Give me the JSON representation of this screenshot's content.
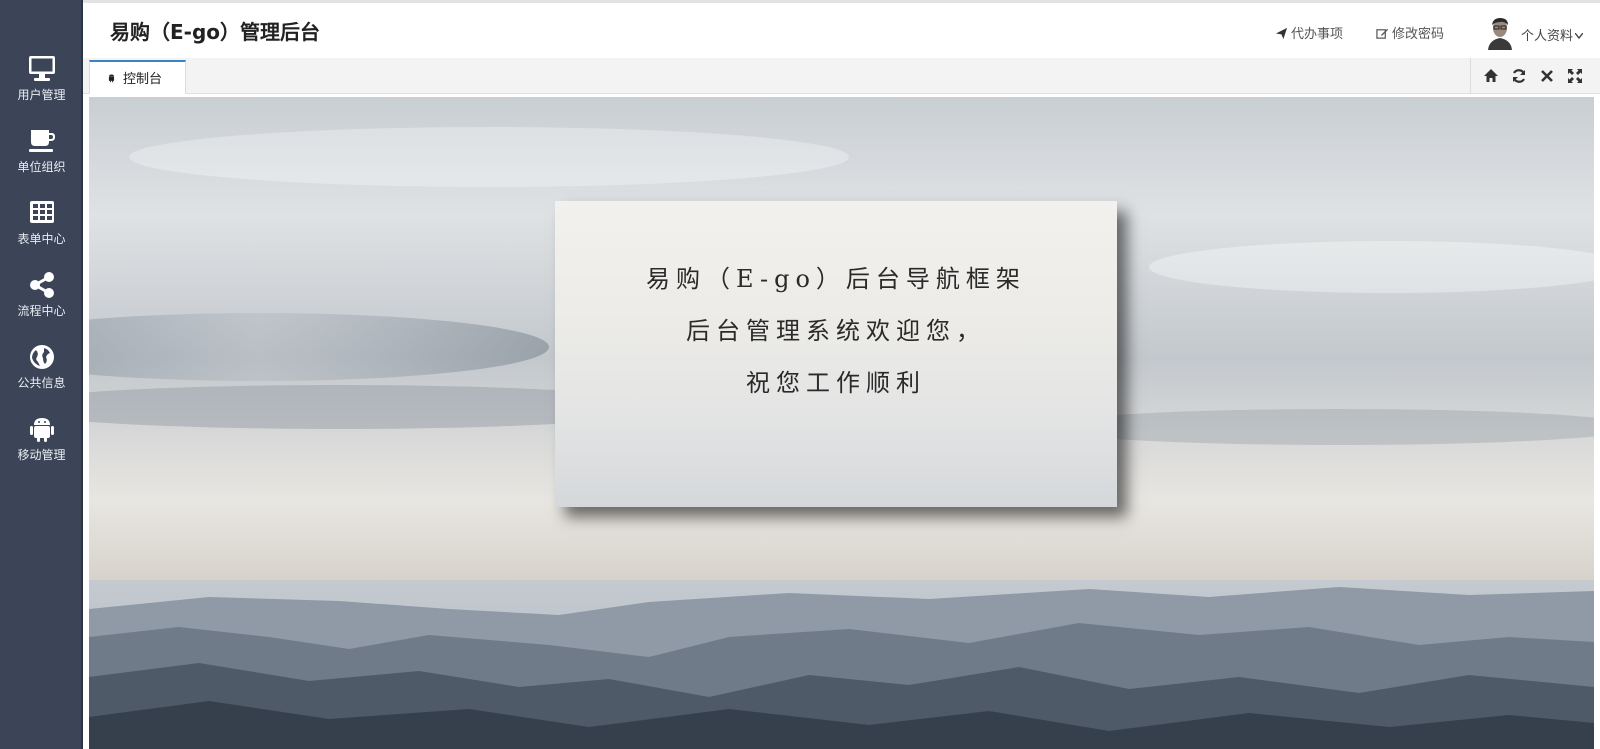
{
  "header": {
    "app_title": "易购（E-go）管理后台",
    "todo_label": "代办事项",
    "change_password_label": "修改密码",
    "profile_label": "个人资料"
  },
  "sidebar": {
    "items": [
      {
        "label": "用户管理",
        "icon": "monitor-icon"
      },
      {
        "label": "单位组织",
        "icon": "coffee-cup-icon"
      },
      {
        "label": "表单中心",
        "icon": "table-icon"
      },
      {
        "label": "流程中心",
        "icon": "share-icon"
      },
      {
        "label": "公共信息",
        "icon": "globe-icon"
      },
      {
        "label": "移动管理",
        "icon": "android-icon"
      }
    ]
  },
  "tabs": [
    {
      "label": "控制台",
      "icon": "android-icon",
      "active": true
    }
  ],
  "tab_tools": [
    "home-icon",
    "refresh-icon",
    "close-icon",
    "fullscreen-icon"
  ],
  "welcome": {
    "line1": "易购（E-go）后台导航框架",
    "line2": "后台管理系统欢迎您，",
    "line3": "祝您工作顺利"
  },
  "colors": {
    "sidebar_bg": "#3b4557",
    "tab_accent": "#3a84c6"
  }
}
